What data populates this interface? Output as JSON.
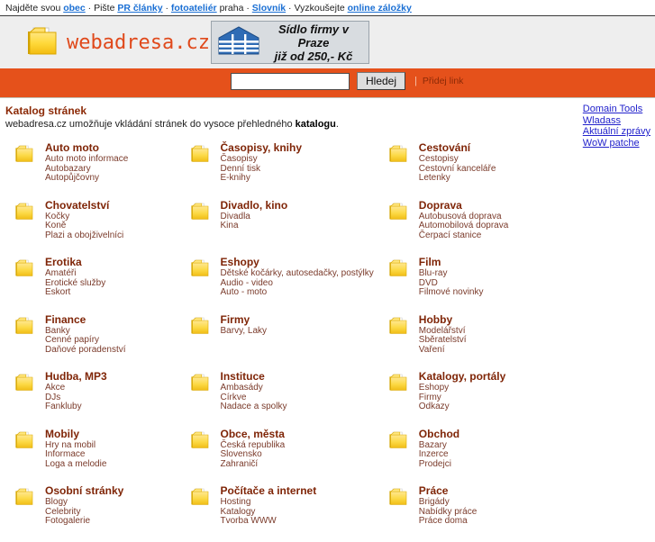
{
  "topbar": {
    "parts": [
      {
        "text": "Najděte svou ",
        "link": false
      },
      {
        "text": "obec",
        "link": true
      },
      {
        "text": " · ",
        "link": false
      },
      {
        "text": "Pište ",
        "link": false
      },
      {
        "text": "PR články",
        "link": true
      },
      {
        "text": " · ",
        "link": false
      },
      {
        "text": "fotoateliér",
        "link": true
      },
      {
        "text": " praha",
        "link": false
      },
      {
        "text": " · ",
        "link": false
      },
      {
        "text": "Slovník",
        "link": true
      },
      {
        "text": " · ",
        "link": false
      },
      {
        "text": "Vyzkoušejte ",
        "link": false
      },
      {
        "text": "online záložky",
        "link": true
      }
    ]
  },
  "header": {
    "logo_text": "webadresa.cz",
    "banner": {
      "line1": "Sídlo firmy v Praze",
      "line2": "již od 250,- Kč"
    }
  },
  "search": {
    "value": "",
    "placeholder": "",
    "button_label": "Hledej",
    "separator": "|",
    "add_link_label": "Přidej link"
  },
  "intro": {
    "heading": "Katalog stránek",
    "text_before": "webadresa.cz umožňuje vkládání stránek do vysoce přehledného ",
    "text_bold": "katalogu",
    "text_after": "."
  },
  "sidelinks": {
    "items": [
      {
        "label": "Domain Tools"
      },
      {
        "label": "Wladass"
      },
      {
        "label": "Aktuální zprávy"
      },
      {
        "label": "WoW patche"
      }
    ]
  },
  "colors": {
    "orange_band": "#e5511b",
    "header_bg": "#eeeeee",
    "logo_text": "#e0491b",
    "category_title": "#7f2507",
    "sublink": "#7a3a2a",
    "sidelink": "#2222cc",
    "topbar_link": "#1a6fd4"
  },
  "categories": [
    {
      "title": "Auto moto",
      "icon": "folder-icon",
      "subs": [
        "Auto moto informace",
        "Autobazary",
        "Autopůjčovny"
      ]
    },
    {
      "title": "Časopisy, knihy",
      "icon": "folder-icon",
      "subs": [
        "Časopisy",
        "Denní tisk",
        "E-knihy"
      ]
    },
    {
      "title": "Cestování",
      "icon": "folder-icon",
      "subs": [
        "Cestopisy",
        "Cestovní kanceláře",
        "Letenky"
      ]
    },
    {
      "title": "Chovatelství",
      "icon": "folder-icon",
      "subs": [
        "Kočky",
        "Koně",
        "Plazi a obojživelníci"
      ]
    },
    {
      "title": "Divadlo, kino",
      "icon": "folder-icon",
      "subs": [
        "Divadla",
        "Kina"
      ]
    },
    {
      "title": "Doprava",
      "icon": "folder-icon",
      "subs": [
        "Autobusová doprava",
        "Automobilová doprava",
        "Čerpací stanice"
      ]
    },
    {
      "title": "Erotika",
      "icon": "folder-icon",
      "subs": [
        "Amatéři",
        "Erotické služby",
        "Eskort"
      ]
    },
    {
      "title": "Eshopy",
      "icon": "folder-icon",
      "subs": [
        "Dětské kočárky, autosedačky, postýlky",
        "Audio - video",
        "Auto - moto"
      ]
    },
    {
      "title": "Film",
      "icon": "folder-icon",
      "subs": [
        "Blu-ray",
        "DVD",
        "Filmové novinky"
      ]
    },
    {
      "title": "Finance",
      "icon": "folder-icon",
      "subs": [
        "Banky",
        "Cenné papíry",
        "Daňové poradenství"
      ]
    },
    {
      "title": "Firmy",
      "icon": "folder-icon",
      "subs": [
        "Barvy, Laky"
      ]
    },
    {
      "title": "Hobby",
      "icon": "folder-icon",
      "subs": [
        "Modelářství",
        "Sběratelství",
        "Vaření"
      ]
    },
    {
      "title": "Hudba, MP3",
      "icon": "folder-icon",
      "subs": [
        "Akce",
        "DJs",
        "Fankluby"
      ]
    },
    {
      "title": "Instituce",
      "icon": "folder-icon",
      "subs": [
        "Ambasády",
        "Církve",
        "Nadace a spolky"
      ]
    },
    {
      "title": "Katalogy, portály",
      "icon": "folder-icon",
      "subs": [
        "Eshopy",
        "Firmy",
        "Odkazy"
      ]
    },
    {
      "title": "Mobily",
      "icon": "folder-icon",
      "subs": [
        "Hry na mobil",
        "Informace",
        "Loga a melodie"
      ]
    },
    {
      "title": "Obce, města",
      "icon": "folder-icon",
      "subs": [
        "Česká republika",
        "Slovensko",
        "Zahraničí"
      ]
    },
    {
      "title": "Obchod",
      "icon": "folder-icon",
      "subs": [
        "Bazary",
        "Inzerce",
        "Prodejci"
      ]
    },
    {
      "title": "Osobní stránky",
      "icon": "folder-icon",
      "subs": [
        "Blogy",
        "Celebrity",
        "Fotogalerie"
      ]
    },
    {
      "title": "Počítače a internet",
      "icon": "folder-icon",
      "subs": [
        "Hosting",
        "Katalogy",
        "Tvorba WWW"
      ]
    },
    {
      "title": "Práce",
      "icon": "folder-icon",
      "subs": [
        "Brigády",
        "Nabídky práce",
        "Práce doma"
      ]
    }
  ]
}
